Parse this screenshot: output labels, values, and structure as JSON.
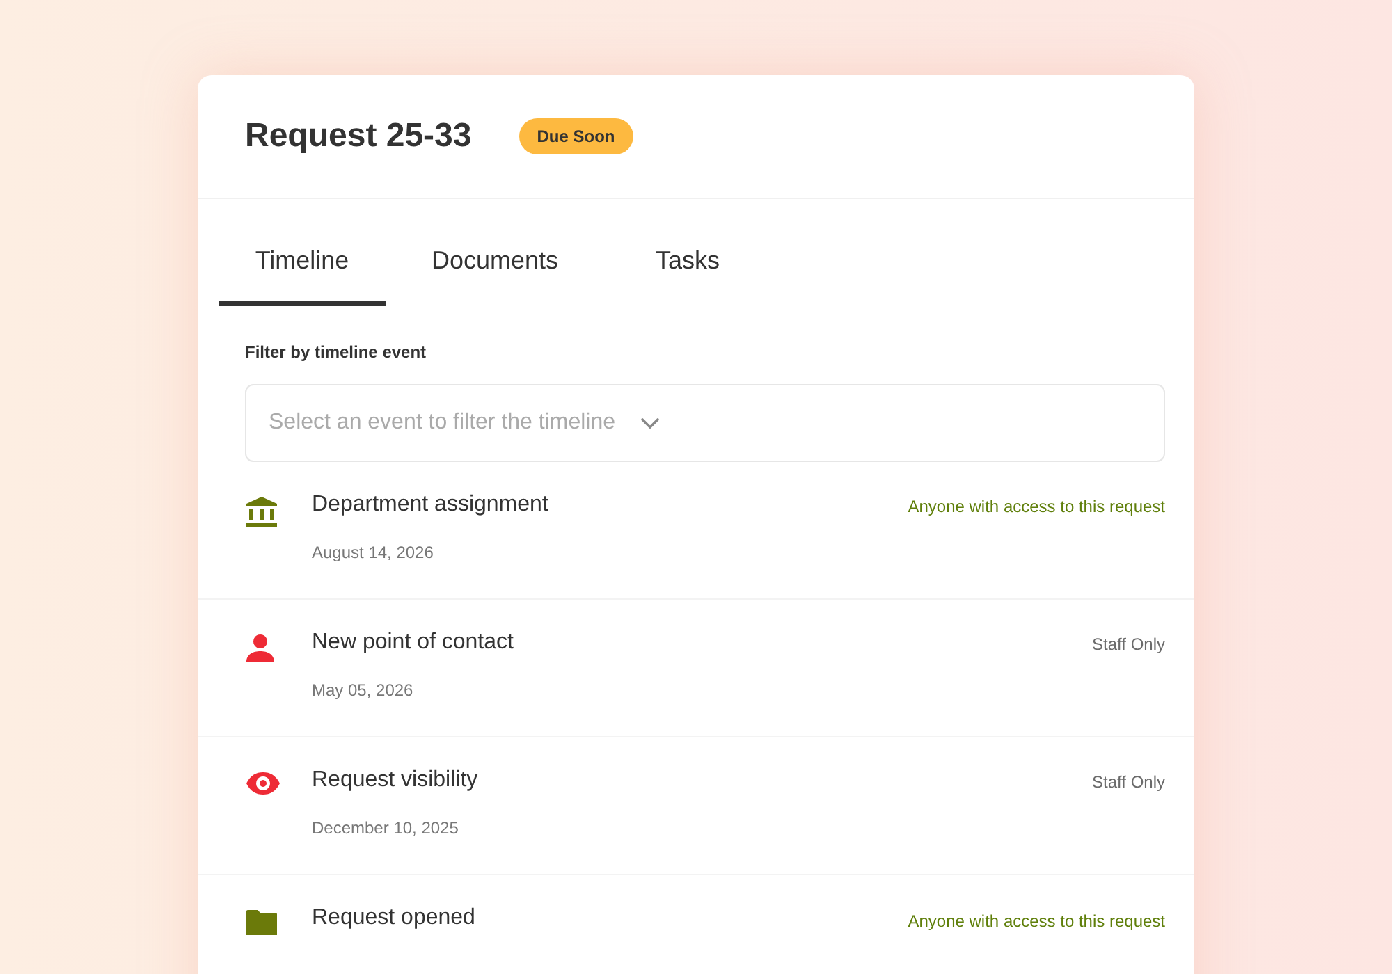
{
  "header": {
    "title": "Request 25-33",
    "badge": "Due Soon"
  },
  "tabs": [
    {
      "label": "Timeline",
      "selected": true
    },
    {
      "label": "Documents",
      "selected": false
    },
    {
      "label": "Tasks",
      "selected": false
    }
  ],
  "filter": {
    "label": "Filter by timeline event",
    "placeholder": "Select an event to filter the timeline"
  },
  "events": [
    {
      "kind": "building",
      "color": "#6b7a0a",
      "title": "Department assignment",
      "date": "August 14, 2026",
      "visibility": {
        "text": "Anyone with access to this request",
        "kind": "public"
      }
    },
    {
      "kind": "person",
      "color": "#ee2b36",
      "title": "New point of contact",
      "date": "May 05, 2026",
      "visibility": {
        "text": "Staff Only",
        "kind": "staff"
      }
    },
    {
      "kind": "eye",
      "color": "#ee2b36",
      "title": "Request visibility",
      "date": "December 10, 2025",
      "visibility": {
        "text": "Staff Only",
        "kind": "staff"
      }
    },
    {
      "kind": "folder",
      "color": "#6b7a0a",
      "title": "Request opened",
      "visibility": {
        "text": "Anyone with access to this request",
        "kind": "public"
      }
    }
  ]
}
